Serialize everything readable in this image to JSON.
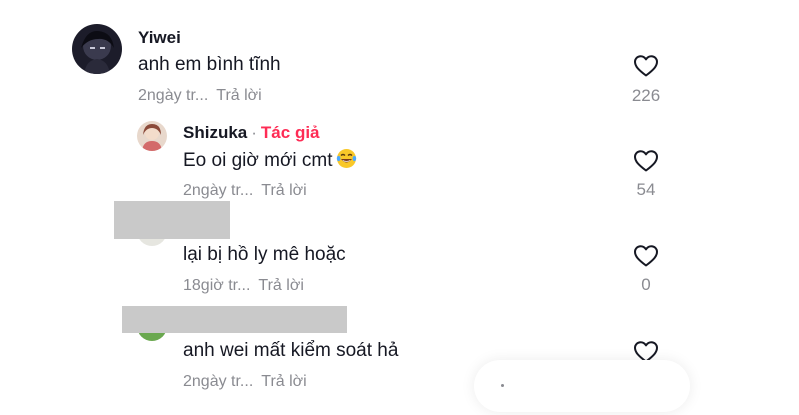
{
  "colors": {
    "text": "#161823",
    "muted": "#8a8b91",
    "author_tag": "#fe2c55",
    "redaction": "#c9c9c9"
  },
  "comments": [
    {
      "username": "Yiwei",
      "text": "anh em bình tĩnh",
      "time": "2ngày tr...",
      "reply_label": "Trả lời",
      "likes": "226",
      "icon": "heart-outline-icon"
    }
  ],
  "replies": [
    {
      "username": "Shizuka",
      "separator": "·",
      "author_label": "Tác giả",
      "text": "Eo oi giờ mới cmt",
      "emoji": "laughing-tears-emoji",
      "time": "2ngày tr...",
      "reply_label": "Trả lời",
      "likes": "54",
      "icon": "heart-outline-icon"
    },
    {
      "username": "",
      "text": "lại bị hồ ly mê hoặc",
      "time": "18giờ tr...",
      "reply_label": "Trả lời",
      "likes": "0",
      "icon": "heart-outline-icon"
    },
    {
      "username": "",
      "text": "anh wei mất kiểm soát hả",
      "time": "2ngày tr...",
      "reply_label": "Trả lời",
      "likes": "",
      "icon": "heart-outline-icon"
    }
  ]
}
